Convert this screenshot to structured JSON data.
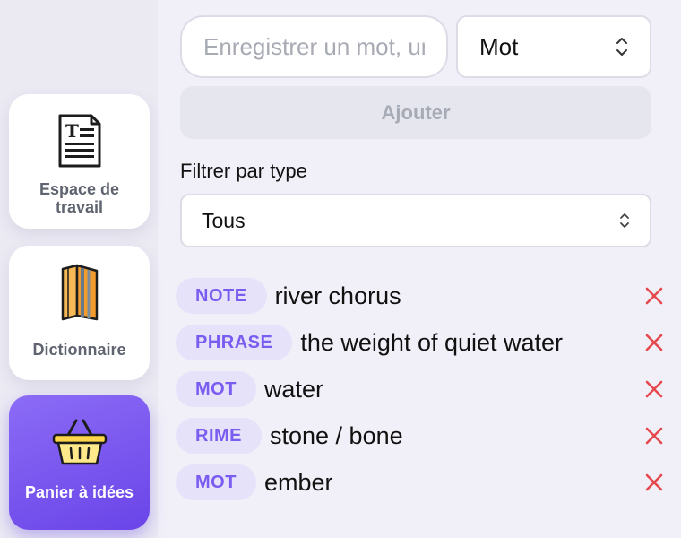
{
  "sidebar": {
    "items": [
      {
        "label": "Espace de travail",
        "icon": "document-text-icon",
        "active": false
      },
      {
        "label": "Dictionnaire",
        "icon": "book-icon",
        "active": false
      },
      {
        "label": "Panier à idées",
        "icon": "basket-icon",
        "active": true
      }
    ]
  },
  "form": {
    "word_placeholder": "Enregistrer un mot, une rime...",
    "word_value": "",
    "type_selected": "Mot",
    "add_label": "Ajouter"
  },
  "filter": {
    "label": "Filtrer par type",
    "selected": "Tous"
  },
  "entries": [
    {
      "type": "NOTE",
      "text": "river chorus"
    },
    {
      "type": "PHRASE",
      "text": "the weight of quiet water"
    },
    {
      "type": "MOT",
      "text": "water"
    },
    {
      "type": "RIME",
      "text": "stone / bone"
    },
    {
      "type": "MOT",
      "text": "ember"
    }
  ],
  "colors": {
    "accent": "#7a5cf0",
    "badge_bg": "#e6e2fa",
    "delete": "#e5484d",
    "active_nav_start": "#8b6cf6",
    "active_nav_end": "#6a44e8"
  }
}
